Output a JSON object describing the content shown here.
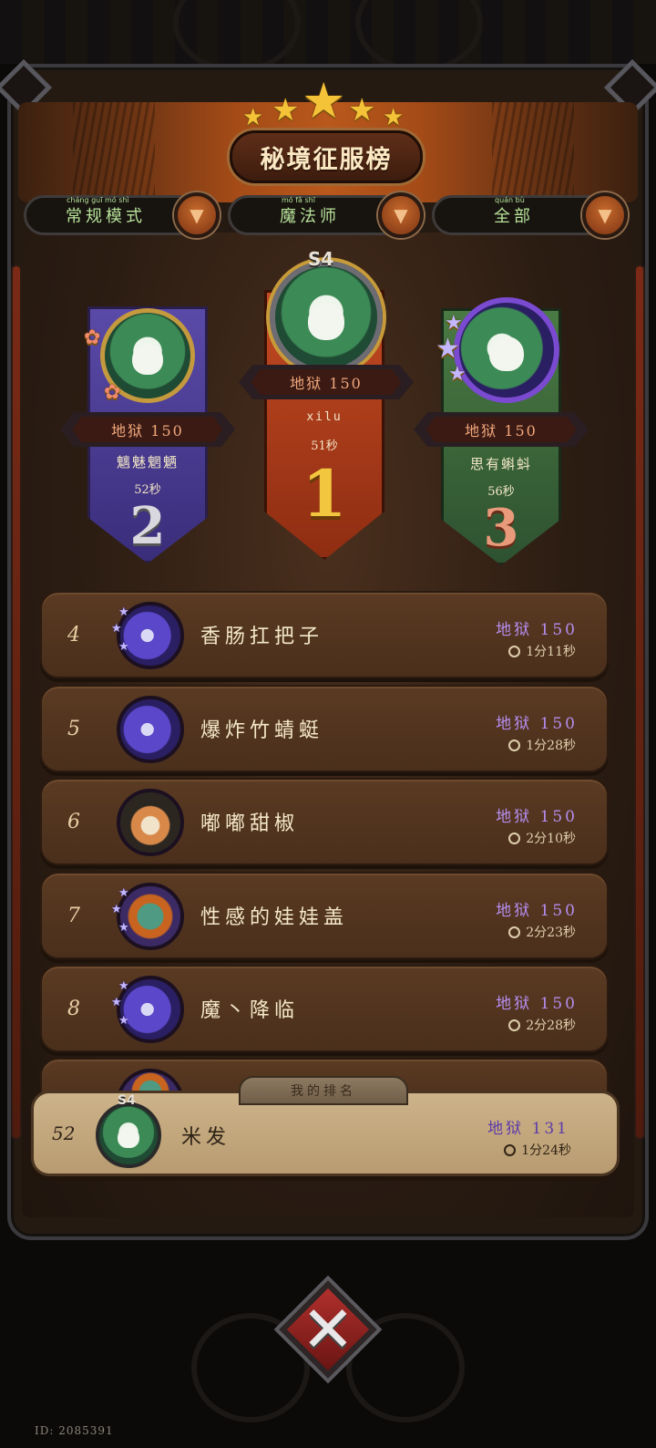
{
  "title": "秘境征服榜",
  "stars": 5,
  "filters": [
    {
      "label": "常规模式",
      "pinyin": "cháng guī mó shì"
    },
    {
      "label": "魔法师",
      "pinyin": "mó fǎ shī"
    },
    {
      "label": "全部",
      "pinyin": "quán bù"
    }
  ],
  "podium": {
    "first": {
      "rank": "1",
      "score": "地狱 150",
      "name": "xilu",
      "time": "51秒",
      "badge": "S4"
    },
    "second": {
      "rank": "2",
      "score": "地狱 150",
      "name": "魑魅魍魉",
      "time": "52秒"
    },
    "third": {
      "rank": "3",
      "score": "地狱 150",
      "name": "思有蝌蚪",
      "time": "56秒"
    }
  },
  "rows": [
    {
      "rank": "4",
      "name": "香肠扛把子",
      "score": "地狱 150",
      "time": "1分11秒",
      "avatar": "moon-crest-starred"
    },
    {
      "rank": "5",
      "name": "爆炸竹蜻蜓",
      "score": "地狱 150",
      "time": "1分28秒",
      "avatar": "moon-crest"
    },
    {
      "rank": "6",
      "name": "嘟嘟甜椒",
      "score": "地狱 150",
      "time": "2分10秒",
      "avatar": "fox-ranger"
    },
    {
      "rank": "7",
      "name": "性感的娃娃盖",
      "score": "地狱 150",
      "time": "2分23秒",
      "avatar": "dragon-starred"
    },
    {
      "rank": "8",
      "name": "魔丶降临",
      "score": "地狱 150",
      "time": "2分28秒",
      "avatar": "moon-crest-starred"
    }
  ],
  "my_rank": {
    "tab_label": "我的排名",
    "rank": "52",
    "name": "米发",
    "score": "地狱 131",
    "time": "1分24秒",
    "badge": "S4"
  },
  "footer": {
    "id_text": "ID: 2085391"
  },
  "colors": {
    "score_purple": "#b58ef0",
    "filter_green": "#b7e39a",
    "banner_red": "#b8421d",
    "banner_purple": "#4b3c93",
    "banner_green": "#3e6b3a"
  }
}
